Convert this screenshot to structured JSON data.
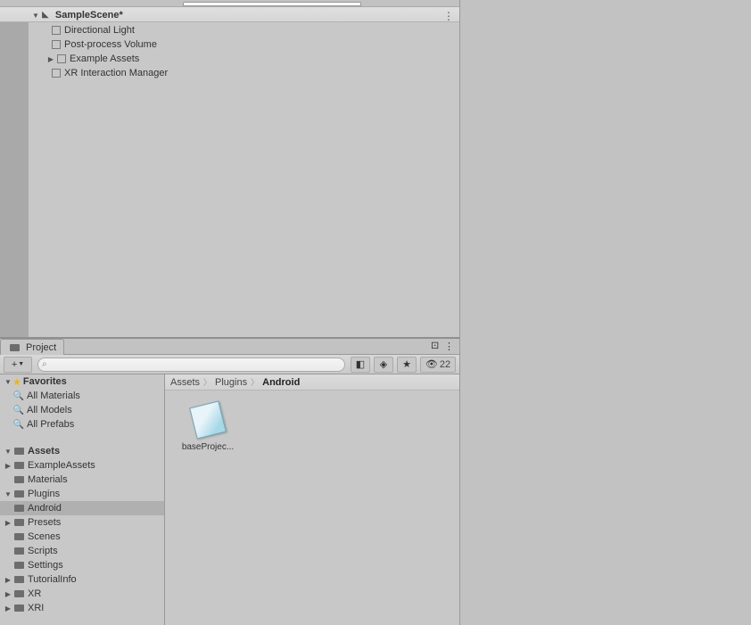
{
  "hierarchy": {
    "scene_name": "SampleScene*",
    "items": [
      {
        "label": "Directional Light",
        "has_children": false
      },
      {
        "label": "Post-process Volume",
        "has_children": false
      },
      {
        "label": "Example Assets",
        "has_children": true
      },
      {
        "label": "XR Interaction Manager",
        "has_children": false
      }
    ]
  },
  "project": {
    "tab_label": "Project",
    "hidden_count": "22",
    "search_placeholder": "",
    "favorites": {
      "header": "Favorites",
      "items": [
        "All Materials",
        "All Models",
        "All Prefabs"
      ]
    },
    "assets": {
      "header": "Assets",
      "items": [
        {
          "label": "ExampleAssets",
          "has_children": true
        },
        {
          "label": "Materials",
          "has_children": false
        },
        {
          "label": "Plugins",
          "has_children": true,
          "expanded": true,
          "children": [
            {
              "label": "Android",
              "selected": true
            }
          ]
        },
        {
          "label": "Presets",
          "has_children": true
        },
        {
          "label": "Scenes",
          "has_children": false
        },
        {
          "label": "Scripts",
          "has_children": false
        },
        {
          "label": "Settings",
          "has_children": false
        },
        {
          "label": "TutorialInfo",
          "has_children": true
        },
        {
          "label": "XR",
          "has_children": true
        },
        {
          "label": "XRI",
          "has_children": true
        }
      ]
    },
    "breadcrumb": [
      "Assets",
      "Plugins",
      "Android"
    ],
    "content_items": [
      {
        "label": "baseProjec..."
      }
    ]
  }
}
